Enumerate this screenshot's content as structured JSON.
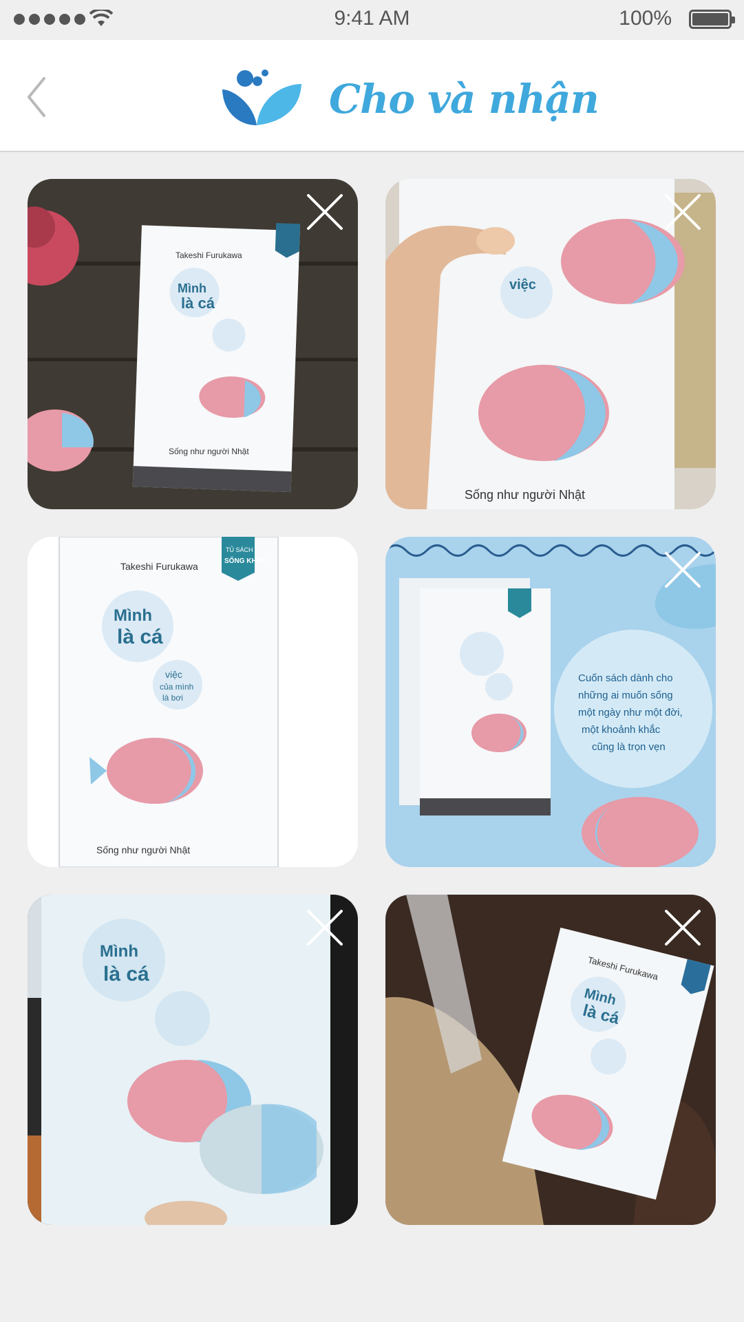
{
  "status_bar": {
    "time": "9:41 AM",
    "battery": "100%"
  },
  "header": {
    "title": "Cho và nhận"
  },
  "book": {
    "author": "Takeshi Furukawa",
    "title_line1": "Mình",
    "title_line2": "là cá",
    "subtitle_1": "việc",
    "subtitle_2": "của mình",
    "subtitle_3": "là bơi",
    "quote": "Sống như người Nhật",
    "series_1": "TỦ SÁCH",
    "series_2": "SỐNG KHÁC",
    "promo_1": "Cuốn sách dành cho",
    "promo_2": "những ai muốn sống",
    "promo_3": "một ngày như một đời,",
    "promo_4": "một khoảnh khắc",
    "promo_5": "cũng là trọn vẹn"
  },
  "colors": {
    "accent": "#3fa8dc",
    "background": "#efeff0",
    "fish_pink": "#e79aa7",
    "fish_blue": "#8fc7e6"
  },
  "photos": [
    {
      "icon": "close-icon"
    },
    {
      "icon": "close-icon"
    },
    {
      "icon": "close-icon"
    },
    {
      "icon": "close-icon"
    },
    {
      "icon": "close-icon"
    },
    {
      "icon": "close-icon"
    }
  ]
}
